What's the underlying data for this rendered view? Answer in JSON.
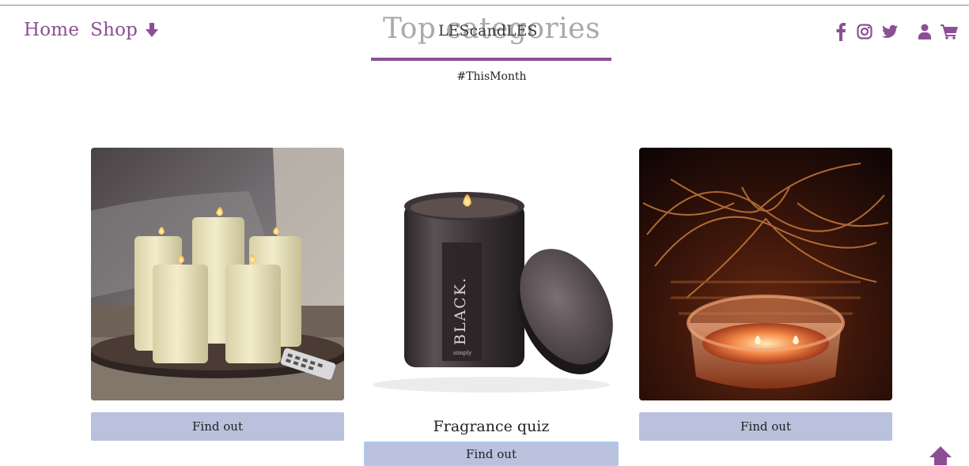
{
  "nav": {
    "home_label": "Home",
    "shop_label": "Shop",
    "shop_icon": "arrow-down-icon"
  },
  "brand": {
    "name": "LEScandLES"
  },
  "section": {
    "title": "Top categories",
    "subtitle": "#ThisMonth"
  },
  "social_icons": [
    "facebook-icon",
    "instagram-icon",
    "twitter-icon"
  ],
  "account_icons": [
    "user-icon",
    "cart-icon"
  ],
  "cards": [
    {
      "image": "pillar-candles-photo",
      "button_label": "Find out"
    },
    {
      "image": "black-jar-candle-photo",
      "caption": "Fragrance quiz",
      "button_label": "Find out"
    },
    {
      "image": "glass-jar-candle-photo",
      "button_label": "Find out"
    }
  ],
  "colors": {
    "accent": "#8c4f95",
    "button_bg": "#b9c1dc",
    "title_gray": "#a9a9a9",
    "focus_outline": "#a9cbee"
  },
  "back_to_top_icon": "arrow-up-icon"
}
